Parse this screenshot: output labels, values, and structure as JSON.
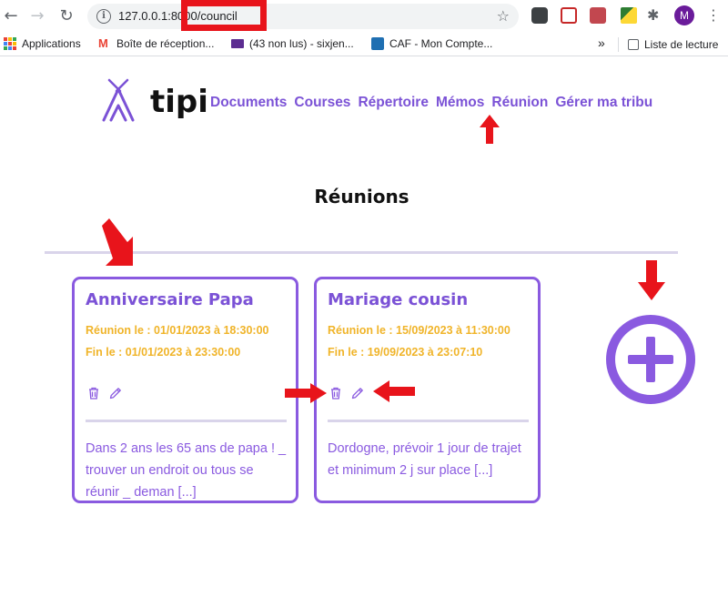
{
  "browser": {
    "url": "127.0.0.1:8000/council",
    "bookmarks": [
      {
        "label": "Applications",
        "icon": "apps-grid-icon"
      },
      {
        "label": "Boîte de réception...",
        "icon": "gmail-icon"
      },
      {
        "label": "(43 non lus) - sixjen...",
        "icon": "mail-envelope-icon"
      },
      {
        "label": "CAF - Mon Compte...",
        "icon": "caf-icon"
      }
    ],
    "more_label": "»",
    "reading_list_label": "Liste de lecture",
    "profile_initial": "M"
  },
  "site": {
    "logo_text": "tipi",
    "nav": [
      "Documents",
      "Courses",
      "Répertoire",
      "Mémos",
      "Réunion",
      "Gérer ma tribu"
    ]
  },
  "page": {
    "title": "Réunions"
  },
  "meetings": [
    {
      "title": "Anniversaire Papa",
      "meta": "Réunion le : 01/01/2023 à 18:30:00 Fin le : 01/01/2023 à 23:30:00",
      "description": "Dans 2 ans les 65 ans de papa ! _ trouver un endroit ou tous se réunir _ deman [...]"
    },
    {
      "title": "Mariage cousin",
      "meta": "Réunion le : 15/09/2023 à 11:30:00 Fin le : 19/09/2023 à 23:07:10",
      "description": "Dordogne, prévoir 1 jour de trajet et minimum 2 j sur place [...]"
    }
  ],
  "colors": {
    "brand_purple": "#7b52d6",
    "meta_yellow": "#f0b429",
    "annotation_red": "#e8141b"
  }
}
